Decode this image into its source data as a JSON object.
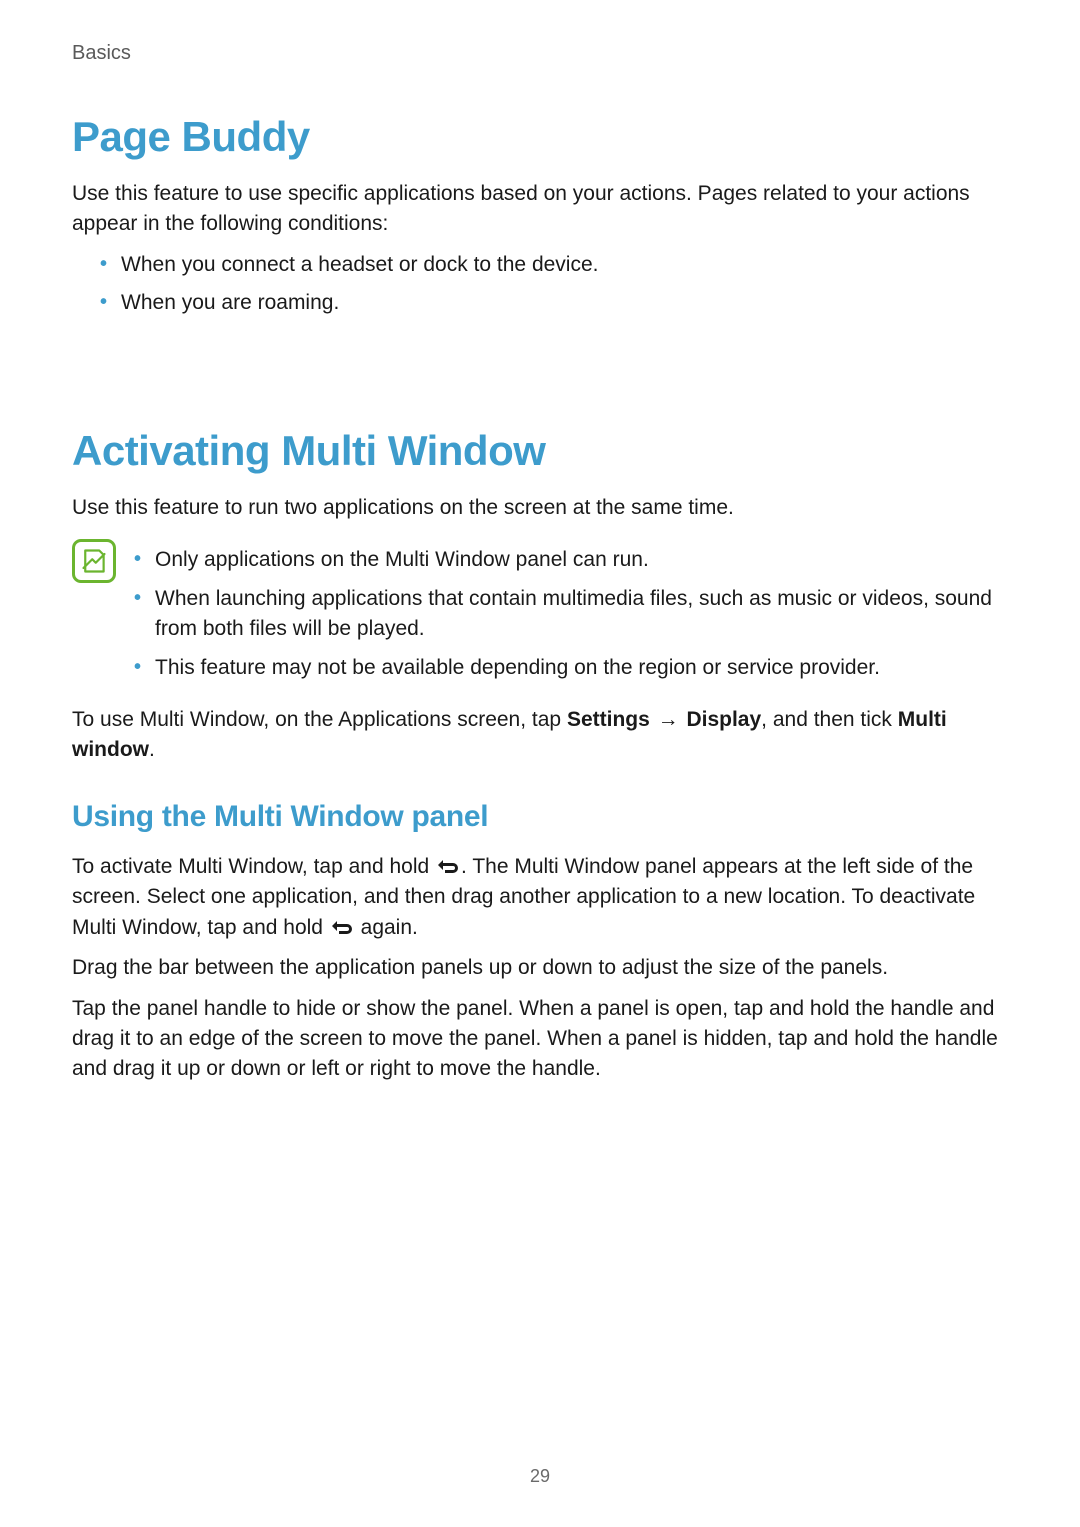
{
  "header": {
    "breadcrumb": "Basics"
  },
  "page_number": "29",
  "sections": {
    "pageBuddy": {
      "title": "Page Buddy",
      "intro": "Use this feature to use specific applications based on your actions. Pages related to your actions appear in the following conditions:",
      "bullets": [
        "When you connect a headset or dock to the device.",
        "When you are roaming."
      ]
    },
    "multiWindow": {
      "title": "Activating Multi Window",
      "intro": "Use this feature to run two applications on the screen at the same time.",
      "notes": [
        "Only applications on the Multi Window panel can run.",
        "When launching applications that contain multimedia files, such as music or videos, sound from both files will be played.",
        "This feature may not be available depending on the region or service provider."
      ],
      "instruction_pre": "To use Multi Window, on the Applications screen, tap ",
      "settings_label": "Settings",
      "arrow": "→",
      "display_label": "Display",
      "instruction_mid": ", and then tick ",
      "multiwindow_label": "Multi window",
      "instruction_post": "."
    },
    "usingPanel": {
      "title": "Using the Multi Window panel",
      "p1_a": "To activate Multi Window, tap and hold ",
      "p1_b": ". The Multi Window panel appears at the left side of the screen. Select one application, and then drag another application to a new location. To deactivate Multi Window, tap and hold ",
      "p1_c": " again.",
      "p2": "Drag the bar between the application panels up or down to adjust the size of the panels.",
      "p3": "Tap the panel handle to hide or show the panel. When a panel is open, tap and hold the handle and drag it to an edge of the screen to move the panel. When a panel is hidden, tap and hold the handle and drag it up or down or left or right to move the handle."
    }
  }
}
